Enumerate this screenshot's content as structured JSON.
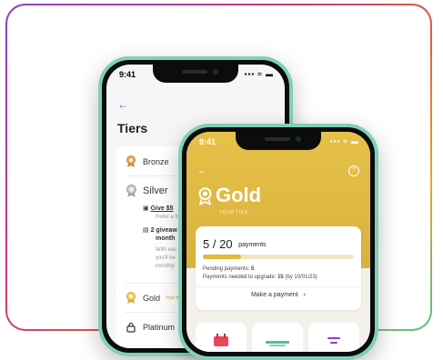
{
  "back_screen": {
    "time": "9:41",
    "status_icons": "▪▪▪ ≈ ▬",
    "title": "Tiers",
    "tiers": [
      {
        "label": "Bronze",
        "icon": "medal-icon",
        "color": "#c98a3a"
      },
      {
        "label": "Silver",
        "icon": "medal-icon",
        "color": "#9aa0a6"
      },
      {
        "label": "Gold",
        "icon": "medal-icon",
        "color": "#e0b93f",
        "tag": "Your tier"
      },
      {
        "label": "Platinum",
        "icon": "lock-icon",
        "color": "#333333"
      }
    ],
    "silver_benefits": [
      {
        "title": "Give $5",
        "desc": "Refer a fr"
      },
      {
        "title": "2 giveaw",
        "title2": "month",
        "desc": "With eac",
        "desc2": "you'll be",
        "desc3": "monthly"
      }
    ]
  },
  "front_screen": {
    "time": "9:41",
    "status_icons": "▪▪▪ ≈ ▬",
    "tier_name": "Gold",
    "your_tier_label": "YOUR TIER",
    "payments_done": "5",
    "payments_total": "20",
    "payments_label": "payments",
    "progress_fraction": 0.25,
    "pending_label": "Pending payments:",
    "pending_value": "5",
    "needed_label": "Payments needed to upgrade:",
    "needed_value": "15",
    "needed_date": "(by 10/01/23)",
    "make_payment_label": "Make a payment",
    "accent": "#8a3fd1",
    "gold": "#e0b93f"
  }
}
